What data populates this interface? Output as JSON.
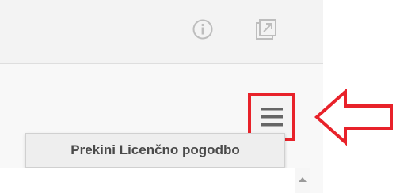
{
  "toolbar": {
    "info_icon": "info-icon",
    "popout_icon": "popout-icon"
  },
  "menu": {
    "icon": "hamburger-menu-icon",
    "items": [
      {
        "label": "Prekini Licenčno pogodbo"
      }
    ]
  },
  "annotation": {
    "highlight_color": "#e8222a",
    "arrow_icon": "left-arrow-outline"
  }
}
